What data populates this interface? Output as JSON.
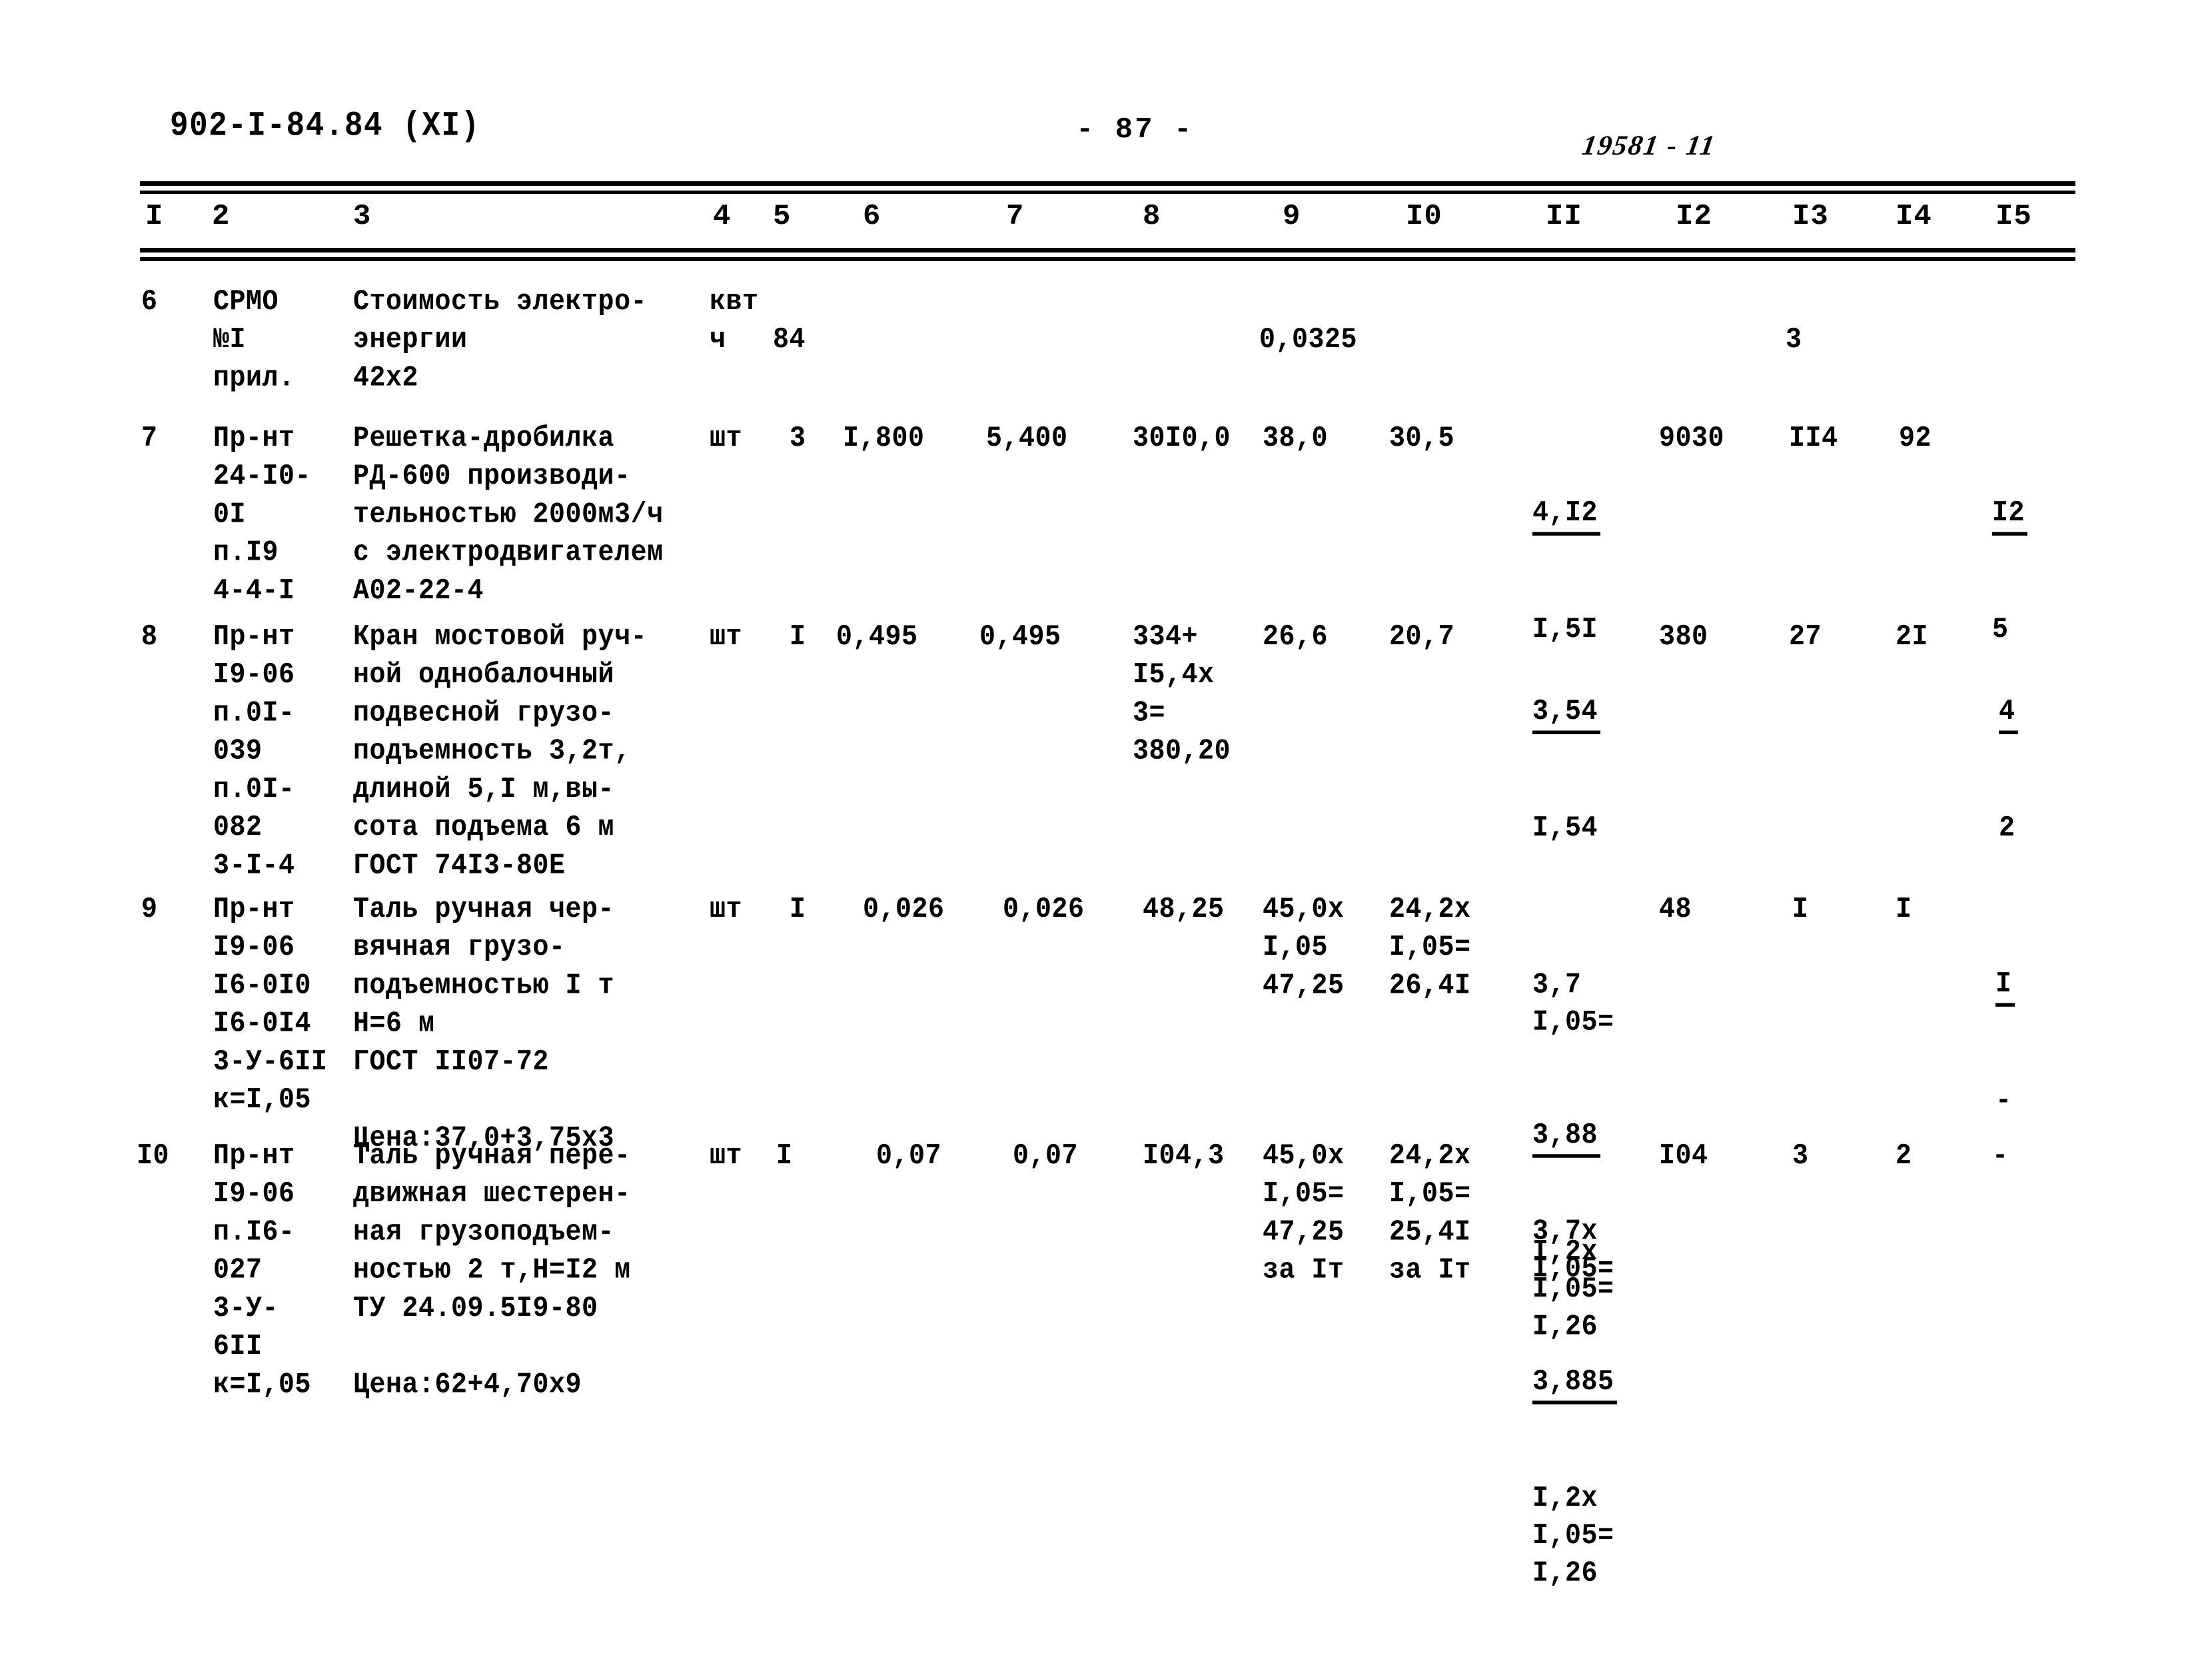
{
  "header": {
    "doc_code": "902-I-84.84 (XI)",
    "page_number": "- 87 -",
    "archive_stamp": "19581 - 11"
  },
  "table": {
    "column_headers": [
      "I",
      "2",
      "3",
      "4",
      "5",
      "6",
      "7",
      "8",
      "9",
      "I0",
      "II",
      "I2",
      "I3",
      "I4",
      "I5"
    ],
    "rows": [
      {
        "pos": "6",
        "code": "СРМО\n№I\nприл.",
        "name": "Стоимость электро-\nэнергии\n42х2",
        "unit": "квт\nч",
        "c5": "\n84",
        "c6": "",
        "c7": "",
        "c8": "",
        "c9": "\n0,0325",
        "c10": "",
        "c11": "",
        "c12": "",
        "c13": "\n3",
        "c14": "",
        "c15": ""
      },
      {
        "pos": "7",
        "code": "Пр-нт\n24-I0-\n0I\nп.I9\n4-4-I",
        "name": "Решетка-дробилка\nРД-600 производи-\nтельностью 2000м3/ч\nс электродвигателем\nА02-22-4",
        "unit": "шт",
        "c5": "3",
        "c6": "I,800",
        "c7": "5,400",
        "c8": "30I0,0",
        "c9": "38,0",
        "c10": "30,5",
        "c11_num": "4,I2",
        "c11_den": "I,5I",
        "c12": "9030",
        "c13": "II4",
        "c14": "92",
        "c15_num": "I2",
        "c15_den": "5"
      },
      {
        "pos": "8",
        "code": "Пр-нт\nI9-06\nп.0I-\n039\nп.0I-\n082\n3-I-4",
        "name": "Кран мостовой руч-\nной однобалочный\nподвесной грузо-\nподъемность 3,2т,\nдлиной 5,I м,вы-\nсота подъема 6 м\nГОСТ 74I3-80Е",
        "unit": "шт",
        "c5": "I",
        "c6": "0,495",
        "c7": "0,495",
        "c8": "334+\nI5,4х\n3=\n380,20",
        "c9": "26,6",
        "c10": "20,7",
        "c11_num": "3,54",
        "c11_den": "I,54",
        "c12": "380",
        "c13": "27",
        "c14": "2I",
        "c15_num": "4",
        "c15_den": "2"
      },
      {
        "pos": "9",
        "code": "Пр-нт\nI9-06\nI6-0I0\nI6-0I4\n3-У-6II\nк=I,05",
        "name": "Таль ручная чер-\nвячная грузо-\nподъемностью I т\nН=6 м\nГОСТ II07-72\n\nЦена:37,0+3,75х3",
        "unit": "шт",
        "c5": "I",
        "c6": "0,026",
        "c7": "0,026",
        "c8": "48,25",
        "c9": "45,0х\nI,05\n47,25",
        "c10": "24,2х\nI,05=\n26,4I",
        "c11_top": "3,7\nI,05=",
        "c11_num": "3,88",
        "c11_tail": "I,2х\nI,05=\nI,26",
        "c12": "48",
        "c13": "I",
        "c14": "I",
        "c15_num": "I",
        "c15_den": "-"
      },
      {
        "pos": "I0",
        "code": "Пр-нт\nI9-06\nп.I6-\n027\n3-У-\n6II\nк=I,05",
        "name": "Таль ручная пере-\nдвижная шестерен-\nная грузоподъем-\nностью 2 т,Н=I2 м\nТУ 24.09.5I9-80\n\nЦена:62+4,70х9",
        "unit": "шт",
        "c5": "I",
        "c6": "0,07",
        "c7": "0,07",
        "c8": "I04,3",
        "c9": "45,0х\nI,05=\n47,25\nза Iт",
        "c10": "24,2х\nI,05=\n25,4I\nза Iт",
        "c11_top": "3,7х\nI,05=",
        "c11_num": "3,885",
        "c11_tail": "I,2х\nI,05=\nI,26",
        "c12": "I04",
        "c13": "3",
        "c14": "2",
        "c15_num": "-",
        "c15_den": ""
      }
    ]
  }
}
